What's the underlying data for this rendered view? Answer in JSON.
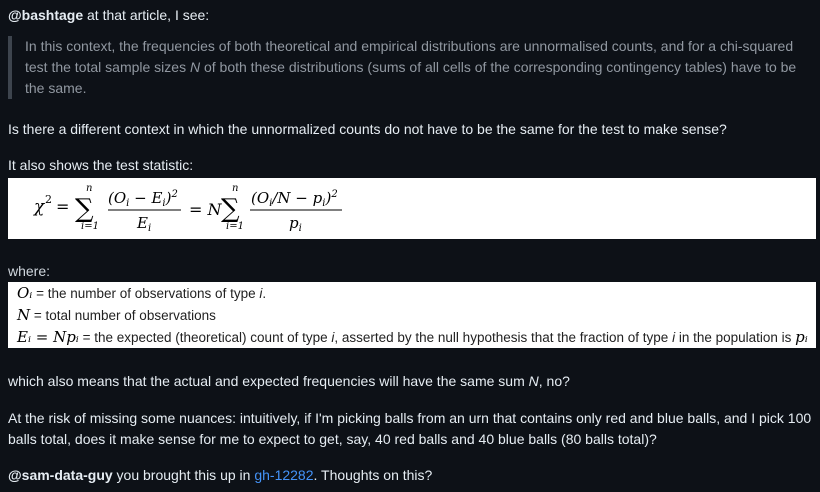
{
  "intro": {
    "mention": "@bashtage",
    "text": " at that article, I see:"
  },
  "quote": {
    "part1": "In this context, the frequencies of both theoretical and empirical distributions are unnormalised counts, and for a chi-squared test the total sample sizes ",
    "n": "N",
    "part2": " of both these distributions (sums of all cells of the corresponding contingency tables) have to be the same."
  },
  "question1": "Is there a different context in which the unnormalized counts do not have to be the same for the test to make sense?",
  "stat_intro": "It also shows the test statistic:",
  "formula": {
    "chi": "χ",
    "sq": "2",
    "eq1": "=",
    "sum1_top": "n",
    "sum1_bottom": "i=1",
    "num1": "(O",
    "num1_sub": "i",
    "num1_mid": " − E",
    "num1_sub2": "i",
    "num1_end": ")",
    "num1_sq": "2",
    "den1": "E",
    "den1_sub": "i",
    "eq2": "= N",
    "sum2_top": "n",
    "sum2_bottom": "i=1",
    "num2": "(O",
    "num2_sub": "i",
    "num2_mid": "/N − p",
    "num2_sub2": "i",
    "num2_end": ")",
    "num2_sq": "2",
    "den2": "p",
    "den2_sub": "i",
    "sigma": "∑"
  },
  "where": "where:",
  "definitions": [
    {
      "sym": "Oᵢ",
      "text_a": " = the number of observations of type ",
      "var": "i",
      "text_b": "."
    },
    {
      "sym": "N",
      "text_a": " = total number of observations",
      "var": "",
      "text_b": ""
    },
    {
      "sym": "Eᵢ = Npᵢ",
      "text_a": " = the expected (theoretical) count of type ",
      "var": "i",
      "text_b": ", asserted by the null hypothesis that the fraction of type ",
      "var2": "i",
      "text_c": " in the population is ",
      "end_sym": "pᵢ"
    }
  ],
  "sum_question": {
    "a": "which also means that the actual and expected frequencies will have the same sum ",
    "n": "N",
    "b": ", no?"
  },
  "urn_question": "At the risk of missing some nuances: intuitively, if I'm picking balls from an urn that contains only red and blue balls, and I pick 100 balls total, does it make sense for me to expect to get, say, 40 red balls and 40 blue balls (80 balls total)?",
  "closing": {
    "mention": "@sam-data-guy",
    "a": " you brought this up in ",
    "link": "gh-12282",
    "b": ". Thoughts on this?"
  },
  "colors": {
    "background": "#0d1117",
    "text": "#e6edf3",
    "quote": "#9198a1",
    "link": "#4493f8"
  }
}
